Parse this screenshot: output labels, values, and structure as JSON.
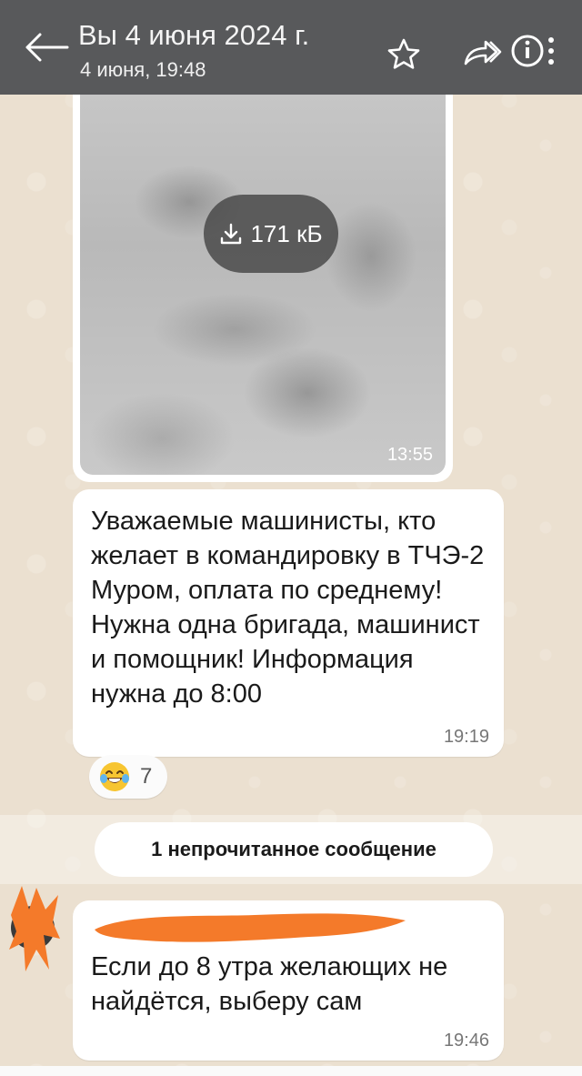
{
  "header": {
    "title": "Вы 4 июня 2024 г.",
    "subtitle": "4 июня, 19:48"
  },
  "image_message": {
    "download_size": "171 кБ",
    "time": "13:55"
  },
  "message_1": {
    "text": "Уважаемые машинисты, кто желает в командировку в ТЧЭ-2 Муром, оплата по среднему! Нужна одна бригада, машинист и помощник! Информация нужна до 8:00",
    "time": "19:19",
    "reaction": {
      "emoji": "tears-of-joy-emoji",
      "count": "7"
    }
  },
  "unread_divider": {
    "label": "1 непрочитанное сообщение"
  },
  "message_2": {
    "text": "Если до 8 утра желающих не найдётся, выберу сам",
    "time": "19:46"
  },
  "colors": {
    "topbar": "#58595b",
    "background": "#ebe0d0",
    "bubble": "#ffffff",
    "scribble": "#f47a2a"
  },
  "icons": [
    "back-arrow-icon",
    "star-icon",
    "forward-icon",
    "info-icon",
    "download-icon"
  ]
}
